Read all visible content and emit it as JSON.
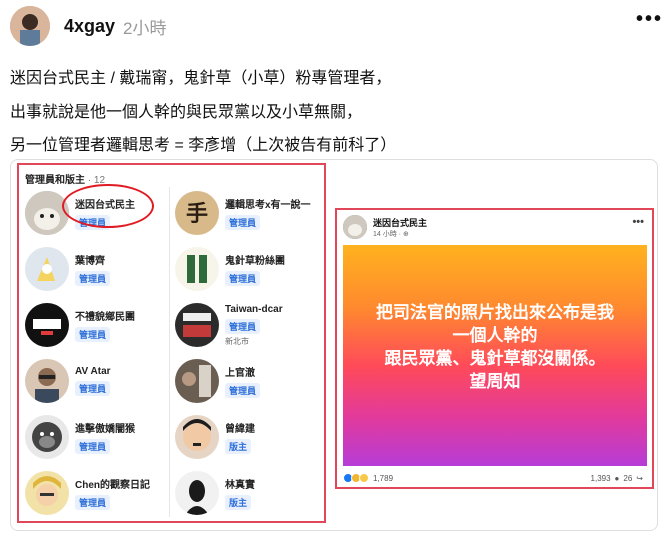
{
  "post": {
    "username": "4xgay",
    "time": "2小時",
    "more_icon": "more-dots-icon",
    "lines": [
      "迷因台式民主 / 戴瑞甯，鬼針草（小草）粉專管理者，",
      "出事就說是他一個人幹的與民眾黨以及小草無關，",
      "另一位管理者邏輯思考 = 李彥增（上次被告有前科了）"
    ]
  },
  "admin_panel": {
    "title": "管理員和版主",
    "count": "· 12",
    "left": [
      {
        "name": "迷因台式民主",
        "role": "管理員"
      },
      {
        "name": "葉博齊",
        "role": "管理員"
      },
      {
        "name": "不禮貌鄉民團",
        "role": "管理員"
      },
      {
        "name": "AV Atar",
        "role": "管理員"
      },
      {
        "name": "進擊傲嬌闇猴",
        "role": "管理員"
      },
      {
        "name": "Chen的觀察日記",
        "role": "管理員"
      }
    ],
    "right": [
      {
        "name": "邏輯思考x有一說一",
        "role": "管理員"
      },
      {
        "name": "鬼針草粉絲團",
        "role": "管理員"
      },
      {
        "name": "Taiwan-dcar",
        "role": "管理員",
        "location": "新北市"
      },
      {
        "name": "上官澈",
        "role": "管理員"
      },
      {
        "name": "曾緯建",
        "role": "版主"
      },
      {
        "name": "林真實",
        "role": "版主"
      }
    ]
  },
  "fb_post": {
    "page_name": "迷因台式民主",
    "time": "14 小時 · ",
    "banner_lines": [
      "把司法官的照片找出來公布是我",
      "一個人幹的",
      "跟民眾黨、鬼針草都沒關係。",
      "望周知"
    ],
    "reactions_count": "1,789",
    "comments_count": "1,393",
    "shares_count": "26"
  },
  "colors": {
    "highlight_border": "#e0485a",
    "circle_mark": "#e01b24",
    "role_text": "#2e6fd8"
  }
}
